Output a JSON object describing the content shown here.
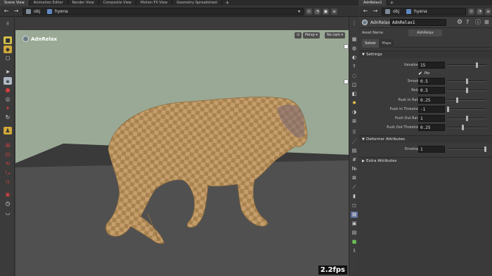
{
  "left_tabs": [
    "Scene View",
    "Animation Editor",
    "Render View",
    "Composite View",
    "Motion FX View",
    "Geometry Spreadsheet"
  ],
  "right_tabs": [
    "AdnRelax1"
  ],
  "left_path": {
    "context": "obj",
    "node": "hyena"
  },
  "right_path": {
    "context": "obj",
    "node": "hyena"
  },
  "viewport": {
    "title": "AdnRelax",
    "camera_mode": "Persp",
    "camera": "No cam",
    "fps": "2.2fps"
  },
  "params": {
    "node_type": "AdnRelax",
    "node_name": "AdnRelax1",
    "asset_name_label": "Asset Name",
    "asset_name_value": "AdnRelax",
    "tabs": [
      "Solver",
      "Maps"
    ],
    "settings_label": "Settings",
    "pin_label": "Pin",
    "rows": [
      {
        "label": "Iterations",
        "value": "15",
        "slider": 0.78
      },
      {
        "label": "Smooth",
        "value": "0.5",
        "slider": 0.5
      },
      {
        "label": "Relax",
        "value": "0.5",
        "slider": 0.5
      },
      {
        "label": "Push In Ratio",
        "value": "0.25",
        "slider": 0.25
      },
      {
        "label": "Push In Threshold",
        "value": "-1",
        "slider": 0.0
      },
      {
        "label": "Push Out Ratio",
        "value": "1",
        "slider": 0.5
      },
      {
        "label": "Push Out Threshold",
        "value": "0.25",
        "slider": 0.4
      }
    ],
    "deformer_label": "Deformer Attributes",
    "envelope": {
      "label": "Envelope",
      "value": "1",
      "slider": 1.0
    },
    "extra_label": "Extra Attributes"
  },
  "colors": {
    "accent": "#d19a28",
    "viewport_bg": "#9aa995",
    "floor": "#4b4b4b"
  }
}
